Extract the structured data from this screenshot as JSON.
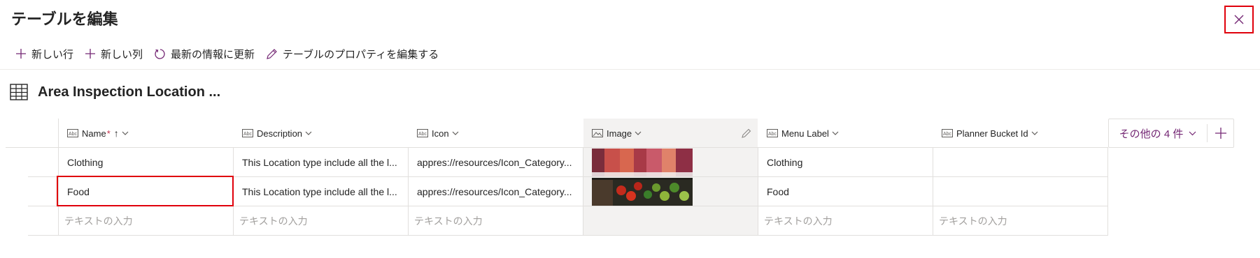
{
  "dialog": {
    "title": "テーブルを編集",
    "close_icon": "close-icon"
  },
  "toolbar": {
    "new_row": "新しい行",
    "new_column": "新しい列",
    "refresh": "最新の情報に更新",
    "edit_properties": "テーブルのプロパティを編集する"
  },
  "table": {
    "name": "Area Inspection Location ...",
    "columns": [
      {
        "label": "Name",
        "required_mark": "*",
        "sort": "↑",
        "type_icon": "text-type-icon"
      },
      {
        "label": "Description",
        "type_icon": "text-type-icon"
      },
      {
        "label": "Icon",
        "type_icon": "text-type-icon"
      },
      {
        "label": "Image",
        "type_icon": "image-type-icon"
      },
      {
        "label": "Menu Label",
        "type_icon": "text-type-icon"
      },
      {
        "label": "Planner Bucket Id",
        "type_icon": "text-type-icon"
      }
    ],
    "more_columns": "その他の 4 件",
    "rows": [
      {
        "name": "Clothing",
        "description": "This Location type include all the l...",
        "icon": "appres://resources/Icon_Category...",
        "image": "clothing-photo",
        "menu_label": "Clothing",
        "planner_bucket_id": ""
      },
      {
        "name": "Food",
        "description": "This Location type include all the l...",
        "icon": "appres://resources/Icon_Category...",
        "image": "food-photo",
        "menu_label": "Food",
        "planner_bucket_id": ""
      }
    ],
    "new_row_placeholder": "テキストの入力"
  },
  "colors": {
    "accent": "#742774",
    "highlight": "#e0000b",
    "image_column_bg": "#f3f2f1"
  }
}
